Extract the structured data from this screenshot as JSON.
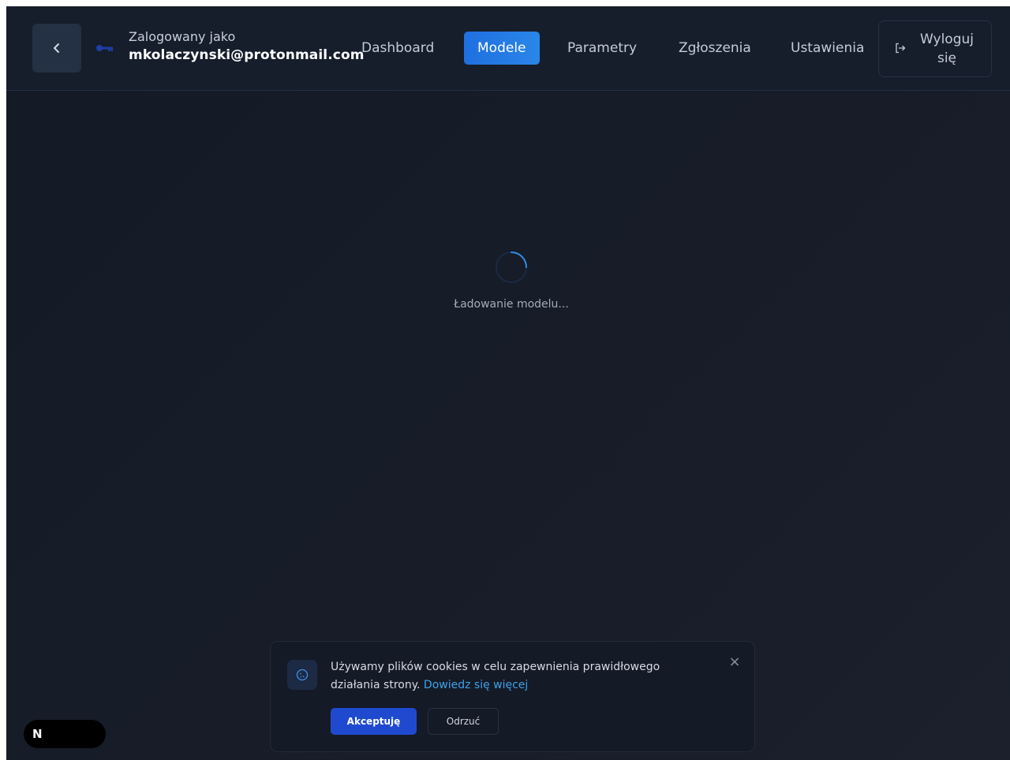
{
  "header": {
    "logged_in_label": "Zalogowany jako",
    "user_email": "mkolaczynski@protonmail.com",
    "nav": [
      {
        "label": "Dashboard",
        "active": false
      },
      {
        "label": "Modele",
        "active": true
      },
      {
        "label": "Parametry",
        "active": false
      },
      {
        "label": "Zgłoszenia",
        "active": false
      },
      {
        "label": "Ustawienia",
        "active": false
      }
    ],
    "logout_label_line1": "Wyloguj",
    "logout_label_line2": "się",
    "icons": [
      "chevron-left-icon",
      "key-icon",
      "logout-icon"
    ]
  },
  "main": {
    "loading_text": "Ładowanie modelu..."
  },
  "cookie_banner": {
    "text": "Używamy plików cookies w celu zapewnienia prawidłowego działania strony.",
    "link_text": "Dowiedz się więcej",
    "accept_label": "Akceptuję",
    "reject_label": "Odrzuć",
    "close_label": "×",
    "icon": "cookie-icon"
  },
  "dev_badge": {
    "label": "N"
  },
  "colors": {
    "accent": "#1f6fe0",
    "accept_button": "#1f4ad0",
    "link": "#3ea2e8",
    "background": "#161c28"
  }
}
